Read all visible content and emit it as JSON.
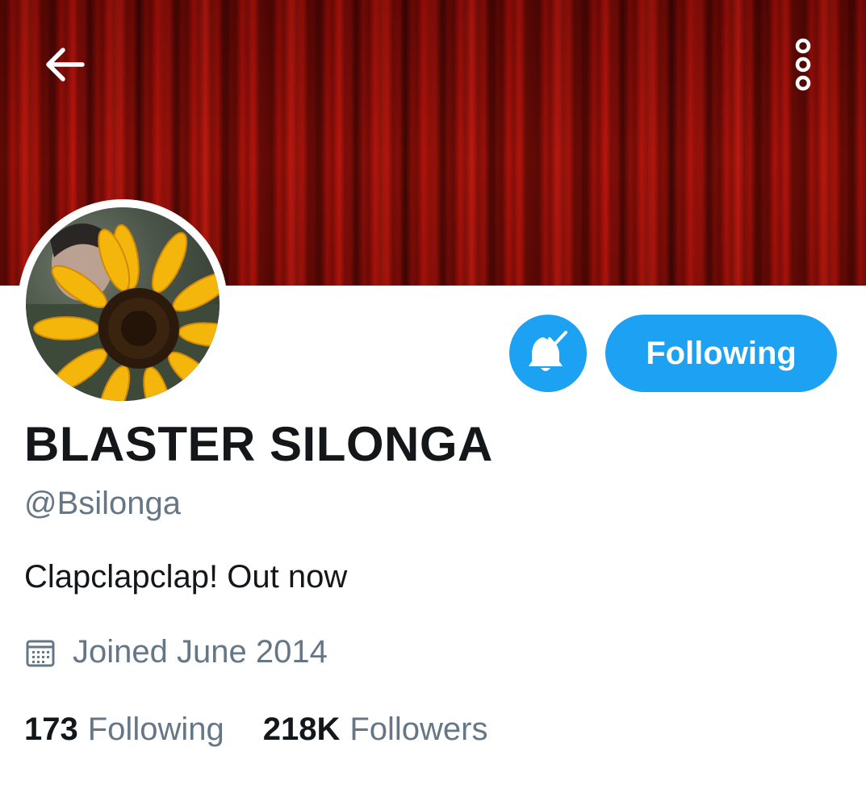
{
  "header": {
    "back_icon": "arrow-left-icon",
    "more_icon": "more-vertical-icon",
    "banner_color": "#a10f08"
  },
  "profile": {
    "display_name": "BLASTER SILONGA",
    "handle": "@Bsilonga",
    "bio": "Clapclapclap! Out now",
    "joined": "Joined June 2014",
    "joined_icon": "calendar-icon"
  },
  "actions": {
    "notification_icon": "bell-check-icon",
    "follow_label": "Following",
    "accent_color": "#1da1f2"
  },
  "stats": {
    "following_count": "173",
    "following_label": "Following",
    "followers_count": "218K",
    "followers_label": "Followers"
  }
}
